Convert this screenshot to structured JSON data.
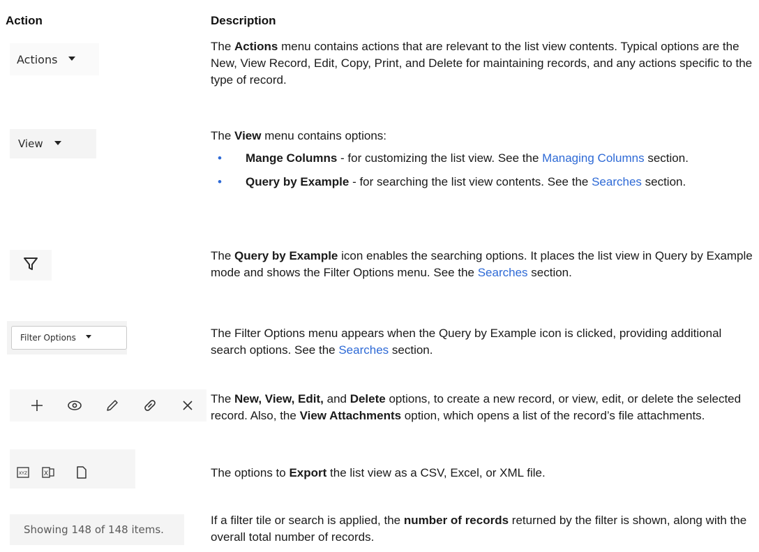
{
  "headers": {
    "action": "Action",
    "description": "Description"
  },
  "rows": [
    {
      "thumb_label": "Actions",
      "desc": {
        "pre": "The ",
        "bold": "Actions",
        "post": " menu contains actions that are relevant to the list view contents. Typical options are the New, View Record, Edit, Copy, Print, and Delete for maintaining records, and any actions specific to the type of record."
      }
    },
    {
      "thumb_label": "View",
      "desc": {
        "pre": "The ",
        "bold": "View",
        "post": " menu contains options:",
        "bullets": [
          {
            "bullet": "•",
            "bold": "Mange Columns",
            "text": " - for customizing the list view. See the ",
            "link": "Managing Columns",
            "after": " section."
          },
          {
            "bullet": "•",
            "bold": "Query by Example",
            "text": " - for searching the list view contents. See the ",
            "link": "Searches",
            "after": " section."
          }
        ]
      }
    },
    {
      "thumb_icon": "filter-funnel-icon",
      "desc": {
        "pre": "The ",
        "bold": "Query by Example",
        "post": " icon enables the searching options. It places the list view in Query by Example mode and shows the Filter Options menu. See the ",
        "link": "Searches",
        "after": " section."
      }
    },
    {
      "thumb_label": "Filter Options",
      "desc": {
        "text": "The Filter Options menu appears when the Query by Example icon is clicked, providing additional search options. See the ",
        "link": "Searches",
        "after": " section."
      }
    },
    {
      "thumb_icons": [
        "plus-icon",
        "eye-icon",
        "pencil-icon",
        "link-icon",
        "close-icon"
      ],
      "desc": {
        "pre": "The ",
        "bold1": "New, View, Edit,",
        "mid1": " and ",
        "bold2": "Delete",
        "mid2": " options, to create a new record, or view, edit, or delete the selected record. Also, the ",
        "bold3": "View Attachments",
        "post": " option, which opens a list of the record’s file attachments."
      }
    },
    {
      "thumb_icons": [
        "export-xml-icon",
        "export-excel-icon",
        "export-csv-icon"
      ],
      "thumb_xml_text": "XYZ",
      "thumb_excel_text": "X",
      "desc": {
        "pre": "The options to ",
        "bold": "Export",
        "post": " the list view as a CSV, Excel, or XML file."
      }
    },
    {
      "thumb_label": "Showing 148 of 148 items.",
      "desc": {
        "pre": "If a filter tile or search is applied, the ",
        "bold": "number of records",
        "post": " returned by the filter is shown, along with the overall total number of records."
      }
    }
  ]
}
